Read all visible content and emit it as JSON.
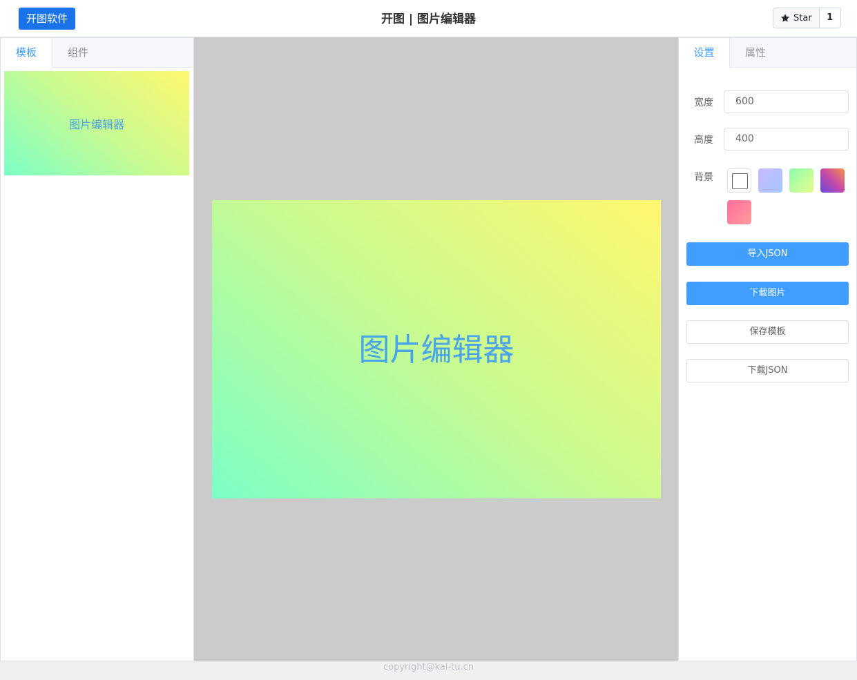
{
  "header": {
    "brand_button": "开图软件",
    "title": "开图 | 图片编辑器",
    "star_label": "Star",
    "star_count": "1"
  },
  "left_panel": {
    "tabs": [
      "模板",
      "组件"
    ],
    "active_tab": 0,
    "templates": [
      {
        "label": "图片编辑器"
      }
    ]
  },
  "canvas": {
    "text": "图片编辑器",
    "background": "linear-gradient #7bffc6 → #fff76f"
  },
  "right_panel": {
    "tabs": [
      "设置",
      "属性"
    ],
    "active_tab": 0,
    "width_label": "宽度",
    "width_value": "600",
    "height_label": "高度",
    "height_value": "400",
    "background_label": "背景",
    "background_swatches": [
      {
        "name": "none",
        "color": "#ffffff"
      },
      {
        "name": "lavender-blue",
        "color": "linear #c8b8ff → #a6c8ff"
      },
      {
        "name": "green-yellow",
        "color": "linear #8efcb0 → #e6fc8a"
      },
      {
        "name": "purple-orange",
        "color": "linear #6a4ad8 → #f88f4a"
      },
      {
        "name": "pink",
        "color": "linear #ff6e9a → #ff9a9e"
      }
    ],
    "buttons": {
      "import_json": "导入JSON",
      "download_image": "下载图片",
      "save_template": "保存模板",
      "download_json": "下载JSON"
    }
  },
  "footer": {
    "copyright": "copyright@kai-tu.cn"
  }
}
